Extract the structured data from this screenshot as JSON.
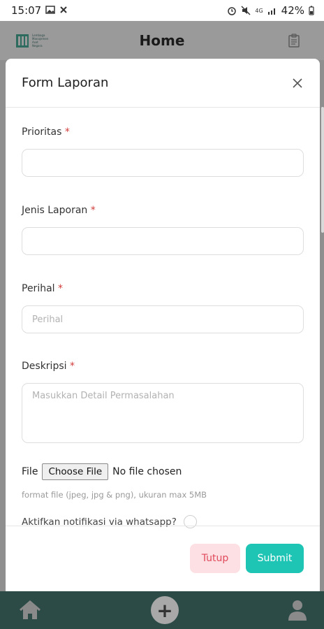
{
  "status_bar": {
    "time": "15:07",
    "battery": "42%",
    "network": "4G"
  },
  "header": {
    "title": "Home",
    "logo_icon": "building-logo-icon",
    "logo_text": [
      "Lembaga",
      "Manajemen",
      "Aset",
      "Negara"
    ],
    "action_icon": "clipboard-icon"
  },
  "modal": {
    "title": "Form Laporan",
    "close_icon": "close-icon",
    "fields": {
      "prioritas": {
        "label": "Prioritas",
        "required": "*",
        "value": ""
      },
      "jenis": {
        "label": "Jenis Laporan",
        "required": "*",
        "value": ""
      },
      "perihal": {
        "label": "Perihal",
        "required": "*",
        "placeholder": "Perihal"
      },
      "deskripsi": {
        "label": "Deskripsi",
        "required": "*",
        "placeholder": "Masukkan Detail Permasalahan"
      }
    },
    "file": {
      "label": "File",
      "button": "Choose File",
      "status": "No file chosen",
      "hint": "format file (jpeg, jpg & png), ukuran max 5MB"
    },
    "notification": {
      "label": "Aktifkan notifikasi via whatsapp?"
    },
    "footer": {
      "close_label": "Tutup",
      "submit_label": "Submit"
    }
  },
  "bottom_nav": {
    "home_icon": "home-icon",
    "add_icon": "plus-icon",
    "add_label": "+",
    "profile_icon": "user-icon"
  },
  "colors": {
    "accent": "#1ec4b4",
    "danger": "#e04a5c",
    "nav": "#2c4b47"
  }
}
